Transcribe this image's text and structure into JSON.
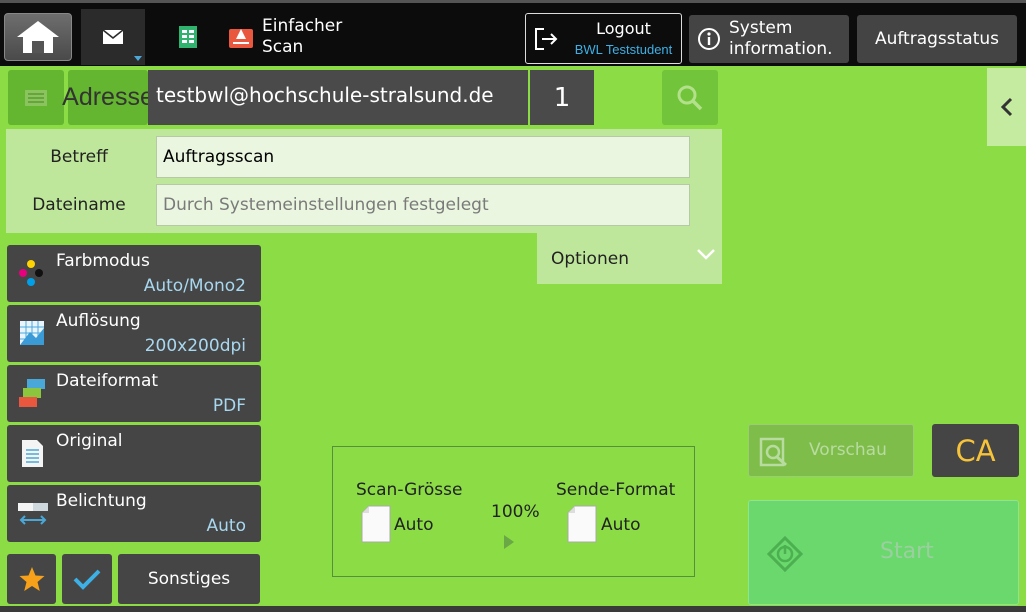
{
  "topbar": {
    "home_icon": "home-icon",
    "tab_mail_icon": "mail-icon",
    "tab_doc_icon": "document-icon",
    "simple_scan_label_line1": "Einfacher",
    "simple_scan_label_line2": "Scan",
    "logout_label": "Logout",
    "logout_user": "BWL Teststudent",
    "sysinfo_label_line1": "System",
    "sysinfo_label_line2": "information.",
    "job_status_label": "Auftragsstatus"
  },
  "address": {
    "label": "Adresse",
    "value": "testbwl@hochschule-stralsund.de",
    "count": "1"
  },
  "form": {
    "subject_label": "Betreff",
    "subject_value": "Auftragsscan",
    "filename_label": "Dateiname",
    "filename_placeholder": "Durch Systemeinstellungen festgelegt",
    "options_label": "Optionen"
  },
  "settings": [
    {
      "title": "Farbmodus",
      "value": "Auto/Mono2",
      "icon": "color-mode-icon"
    },
    {
      "title": "Auflösung",
      "value": "200x200dpi",
      "icon": "resolution-icon"
    },
    {
      "title": "Dateiformat",
      "value": "PDF",
      "icon": "file-format-icon"
    },
    {
      "title": "Original",
      "value": "",
      "icon": "original-icon"
    },
    {
      "title": "Belichtung",
      "value": "Auto",
      "icon": "exposure-icon"
    }
  ],
  "bottom_buttons": {
    "favorite_icon": "star-icon",
    "check_icon": "check-icon",
    "others_label": "Sonstiges"
  },
  "scan_info": {
    "scan_size_label": "Scan-Grösse",
    "scan_size_value": "Auto",
    "ratio": "100%",
    "send_format_label": "Sende-Format",
    "send_format_value": "Auto"
  },
  "actions": {
    "preview_label": "Vorschau",
    "ca_label": "CA",
    "start_label": "Start"
  },
  "colors": {
    "background": "#8bdc45",
    "accent_blue": "#3db0e6",
    "ca_yellow": "#f6c33a",
    "start_green": "#6ad86c"
  }
}
